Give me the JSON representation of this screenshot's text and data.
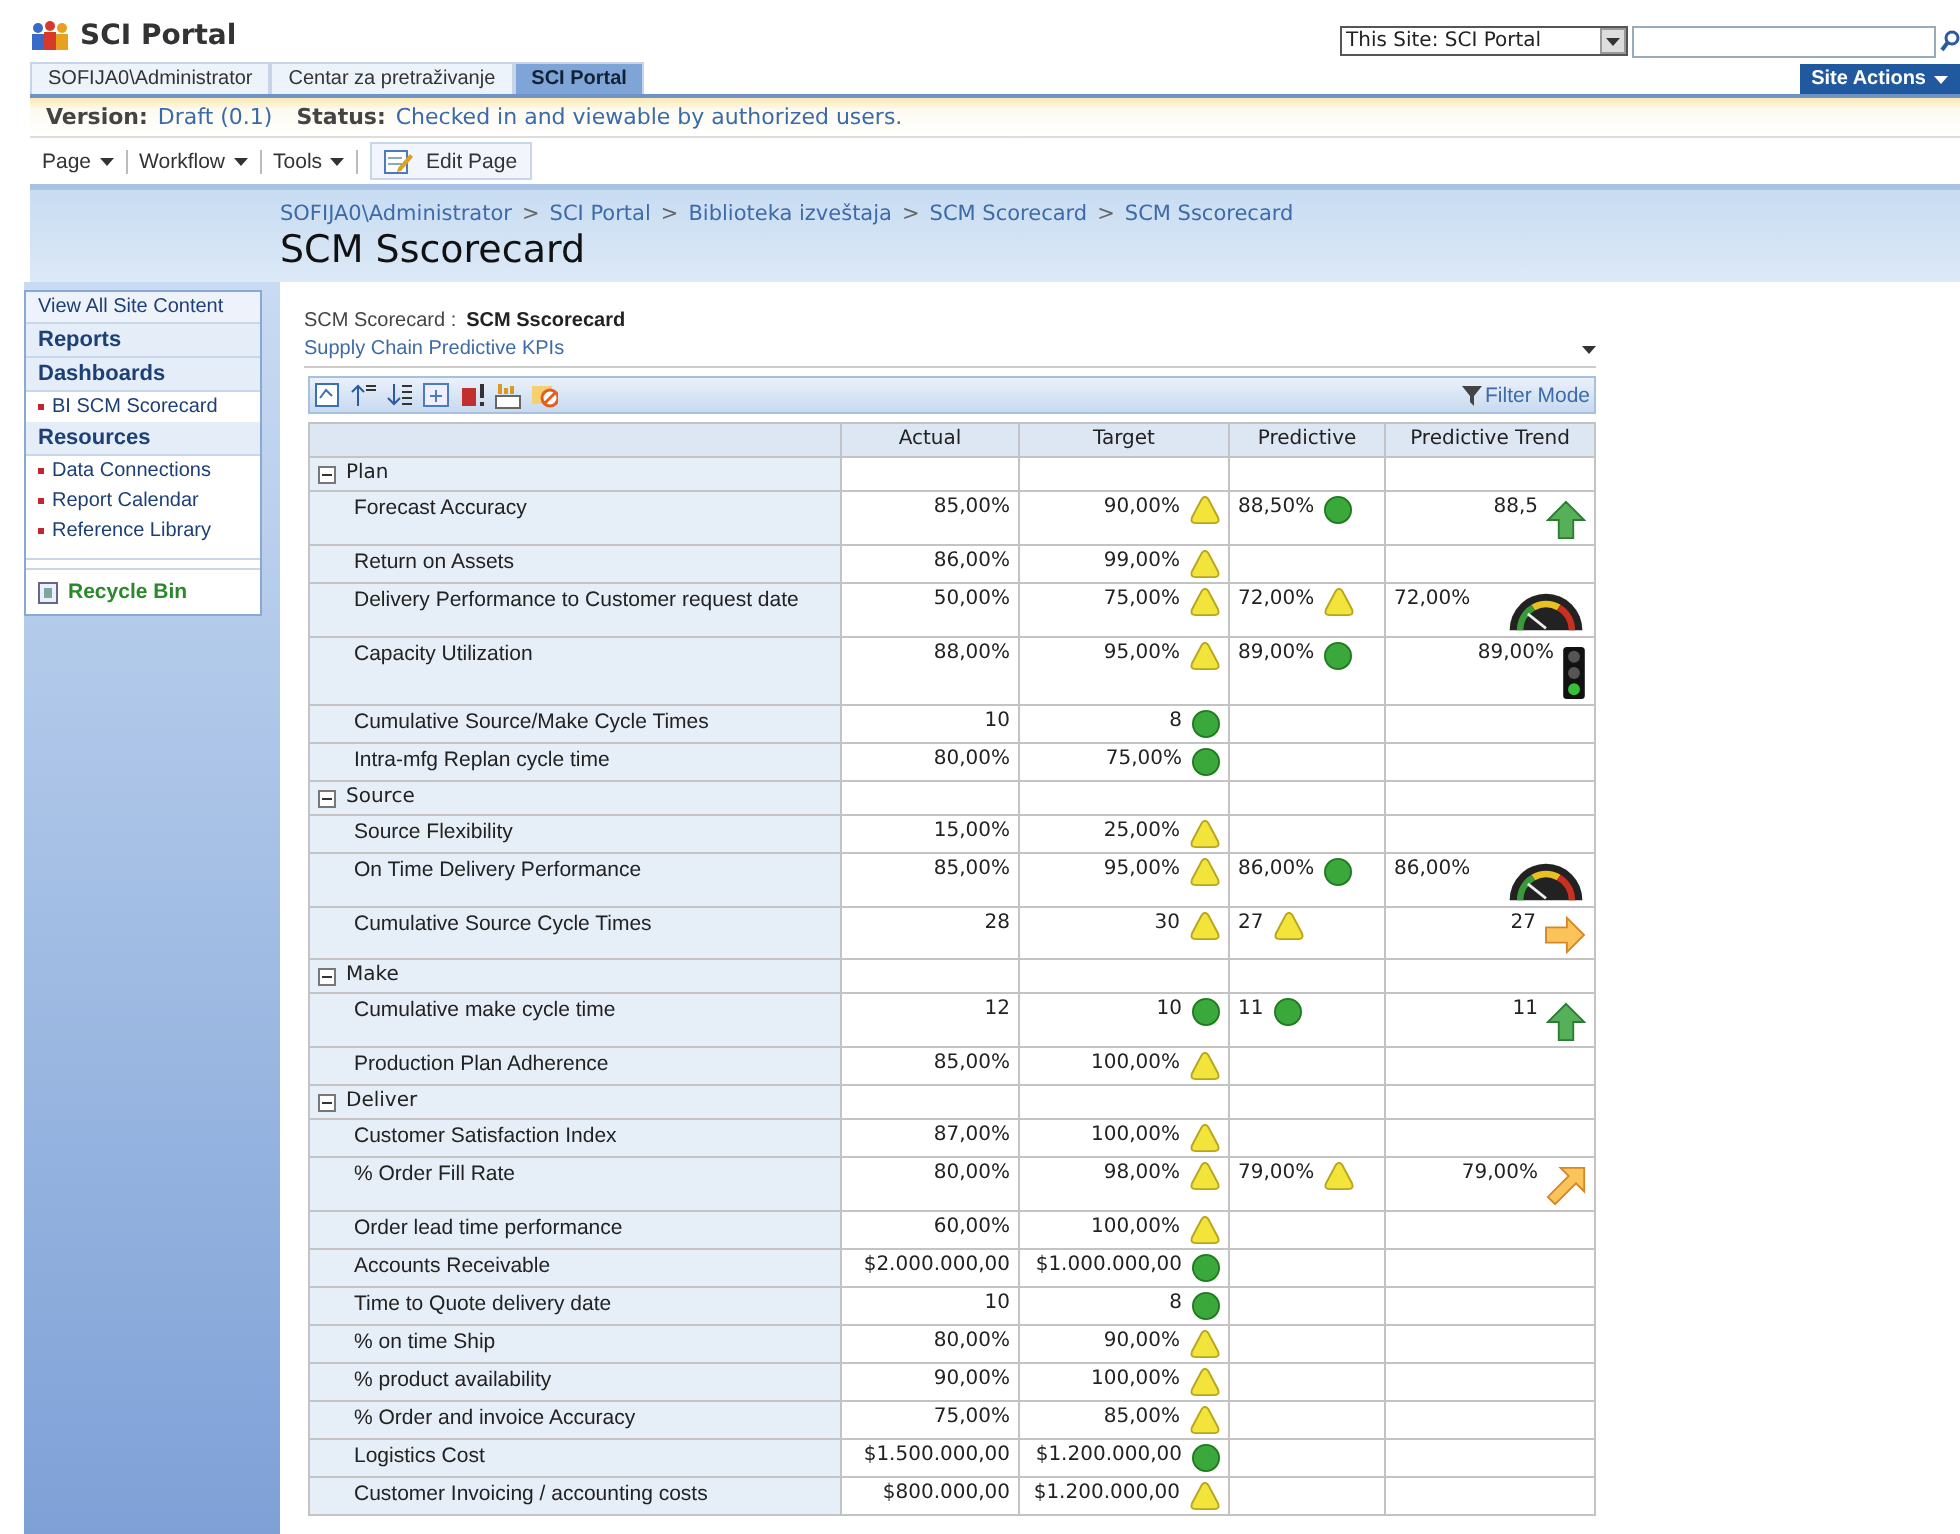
{
  "header": {
    "site_title": "SCI Portal",
    "scope_select": "This Site: SCI Portal",
    "tabs": [
      {
        "label": "SOFIJA0\\Administrator",
        "selected": false
      },
      {
        "label": "Centar za pretraživanje",
        "selected": false
      },
      {
        "label": "SCI Portal",
        "selected": true
      }
    ],
    "site_actions": "Site Actions"
  },
  "version_bar": [
    {
      "label": "Version:",
      "value": "Draft (0.1)"
    },
    {
      "label": "Status:",
      "value": "Checked in and viewable by authorized users."
    }
  ],
  "toolbar": {
    "menus": [
      "Page",
      "Workflow",
      "Tools"
    ],
    "edit_button": "Edit Page"
  },
  "breadcrumb": {
    "separator": ">",
    "items": [
      "SOFIJA0\\Administrator",
      "SCI Portal",
      "Biblioteka izveštaja",
      "SCM Scorecard",
      "SCM Sscorecard"
    ]
  },
  "page_title": "SCM Sscorecard",
  "sidebar": [
    {
      "kind": "link",
      "label": "View All Site Content"
    },
    {
      "kind": "heading",
      "label": "Reports"
    },
    {
      "kind": "heading",
      "label": "Dashboards"
    },
    {
      "kind": "bullet",
      "label": "BI SCM Scorecard"
    },
    {
      "kind": "heading",
      "label": "Resources"
    },
    {
      "kind": "bullet",
      "label": "Data Connections"
    },
    {
      "kind": "bullet",
      "label": "Report Calendar"
    },
    {
      "kind": "bullet",
      "label": "Reference Library"
    },
    {
      "kind": "recycle",
      "label": "Recycle Bin"
    }
  ],
  "scorecard": {
    "label": "SCM Scorecard :",
    "name": "SCM Sscorecard",
    "view": "Supply Chain Predictive KPIs",
    "filter_mode": "Filter Mode",
    "columns": [
      "Actual",
      "Target",
      "Predictive",
      "Predictive Trend"
    ],
    "rows": [
      {
        "kind": "group",
        "name": "Plan",
        "expanded": true
      },
      {
        "kind": "kpi",
        "name": "Forecast Accuracy",
        "actual": "85,00%",
        "target": {
          "value": "90,00%",
          "kind": "warning"
        },
        "predictive": {
          "value": "88,50%",
          "kind": "ok"
        },
        "trend": {
          "value": "88,5",
          "kind": "up"
        }
      },
      {
        "kind": "kpi",
        "name": "Return on Assets",
        "actual": "86,00%",
        "target": {
          "value": "99,00%",
          "kind": "warning"
        }
      },
      {
        "kind": "kpi",
        "name": "Delivery Performance to Customer request date",
        "actual": "50,00%",
        "target": {
          "value": "75,00%",
          "kind": "warning"
        },
        "predictive": {
          "value": "72,00%",
          "kind": "warning"
        },
        "trend": {
          "value": "72,00%",
          "kind": "gauge"
        }
      },
      {
        "kind": "kpi",
        "name": "Capacity Utilization",
        "actual": "88,00%",
        "target": {
          "value": "95,00%",
          "kind": "warning"
        },
        "predictive": {
          "value": "89,00%",
          "kind": "ok"
        },
        "trend": {
          "value": "89,00%",
          "kind": "light"
        }
      },
      {
        "kind": "kpi",
        "name": "Cumulative Source/Make Cycle Times",
        "actual": "10",
        "target": {
          "value": "8",
          "kind": "ok"
        }
      },
      {
        "kind": "kpi",
        "name": "Intra-mfg Replan cycle time",
        "actual": "80,00%",
        "target": {
          "value": "75,00%",
          "kind": "ok"
        }
      },
      {
        "kind": "group",
        "name": "Source",
        "expanded": true
      },
      {
        "kind": "kpi",
        "name": "Source Flexibility",
        "actual": "15,00%",
        "target": {
          "value": "25,00%",
          "kind": "warning"
        }
      },
      {
        "kind": "kpi",
        "name": "On Time Delivery Performance",
        "actual": "85,00%",
        "target": {
          "value": "95,00%",
          "kind": "warning"
        },
        "predictive": {
          "value": "86,00%",
          "kind": "ok"
        },
        "trend": {
          "value": "86,00%",
          "kind": "gauge"
        }
      },
      {
        "kind": "kpi",
        "name": "Cumulative Source Cycle Times",
        "actual": "28",
        "target": {
          "value": "30",
          "kind": "warning"
        },
        "predictive": {
          "value": "27",
          "kind": "warning"
        },
        "trend": {
          "value": "27",
          "kind": "flat"
        }
      },
      {
        "kind": "group",
        "name": "Make",
        "expanded": true
      },
      {
        "kind": "kpi",
        "name": "Cumulative make cycle time",
        "actual": "12",
        "target": {
          "value": "10",
          "kind": "ok"
        },
        "predictive": {
          "value": "11",
          "kind": "ok"
        },
        "trend": {
          "value": "11",
          "kind": "up"
        }
      },
      {
        "kind": "kpi",
        "name": "Production Plan Adherence",
        "actual": "85,00%",
        "target": {
          "value": "100,00%",
          "kind": "warning"
        }
      },
      {
        "kind": "group",
        "name": "Deliver",
        "expanded": true
      },
      {
        "kind": "kpi",
        "name": "Customer Satisfaction Index",
        "actual": "87,00%",
        "target": {
          "value": "100,00%",
          "kind": "warning"
        }
      },
      {
        "kind": "kpi",
        "name": "% Order Fill Rate",
        "actual": "80,00%",
        "target": {
          "value": "98,00%",
          "kind": "warning"
        },
        "predictive": {
          "value": "79,00%",
          "kind": "warning"
        },
        "trend": {
          "value": "79,00%",
          "kind": "rising"
        }
      },
      {
        "kind": "kpi",
        "name": "Order lead time performance",
        "actual": "60,00%",
        "target": {
          "value": "100,00%",
          "kind": "warning"
        }
      },
      {
        "kind": "kpi",
        "name": "Accounts Receivable",
        "actual": "$2.000.000,00",
        "target": {
          "value": "$1.000.000,00",
          "kind": "ok"
        }
      },
      {
        "kind": "kpi",
        "name": "Time to Quote delivery date",
        "actual": "10",
        "target": {
          "value": "8",
          "kind": "ok"
        }
      },
      {
        "kind": "kpi",
        "name": "% on time Ship",
        "actual": "80,00%",
        "target": {
          "value": "90,00%",
          "kind": "warning"
        }
      },
      {
        "kind": "kpi",
        "name": "% product availability",
        "actual": "90,00%",
        "target": {
          "value": "100,00%",
          "kind": "warning"
        }
      },
      {
        "kind": "kpi",
        "name": "% Order and invoice Accuracy",
        "actual": "75,00%",
        "target": {
          "value": "85,00%",
          "kind": "warning"
        }
      },
      {
        "kind": "kpi",
        "name": "Logistics Cost",
        "actual": "$1.500.000,00",
        "target": {
          "value": "$1.200.000,00",
          "kind": "ok"
        }
      },
      {
        "kind": "kpi",
        "name": "Customer Invoicing / accounting costs",
        "actual": "$800.000,00",
        "target": {
          "value": "$1.200.000,00",
          "kind": "warning"
        }
      }
    ]
  }
}
